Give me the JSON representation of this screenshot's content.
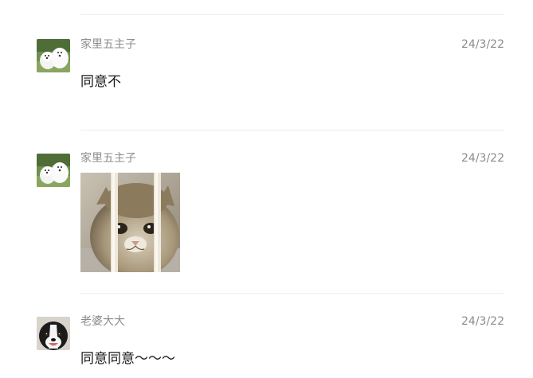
{
  "messages": [
    {
      "sender": "家里五主子",
      "date": "24/3/22",
      "text": "同意不",
      "avatar_icon": "samoyed-dogs-avatar-icon"
    },
    {
      "sender": "家里五主子",
      "date": "24/3/22",
      "image_icon": "sad-cat-behind-bars-image",
      "avatar_icon": "samoyed-dogs-avatar-icon"
    },
    {
      "sender": "老婆大大",
      "date": "24/3/22",
      "text": "同意同意～～～",
      "avatar_icon": "border-collie-avatar-icon"
    }
  ],
  "colors": {
    "name_text": "#8c8c8c",
    "body_text": "#191919",
    "divider": "#ededed",
    "background": "#ffffff"
  }
}
